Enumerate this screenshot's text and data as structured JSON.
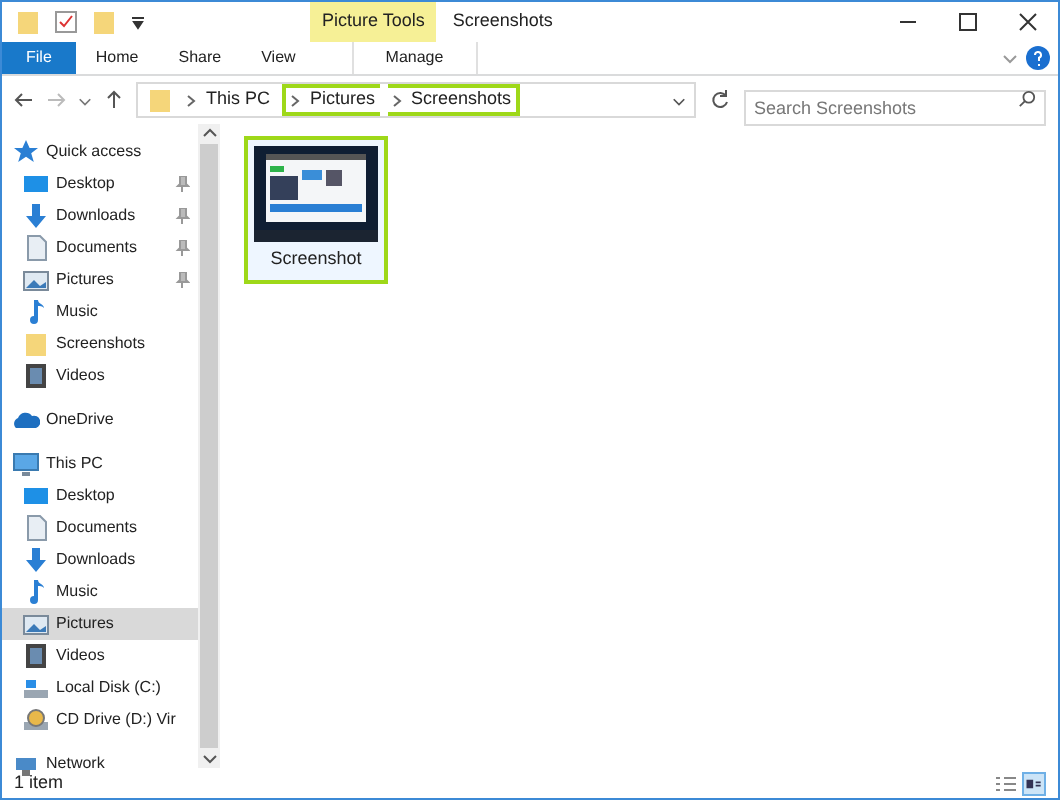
{
  "window": {
    "title": "Screenshots",
    "context_tab": "Picture Tools"
  },
  "ribbon_tabs": [
    {
      "label": "File",
      "kind": "file",
      "selected": false
    },
    {
      "label": "Home",
      "kind": "tab",
      "selected": false
    },
    {
      "label": "Share",
      "kind": "tab",
      "selected": false
    },
    {
      "label": "View",
      "kind": "tab",
      "selected": false
    },
    {
      "label": "Manage",
      "kind": "context",
      "selected": false
    }
  ],
  "address": {
    "crumbs": [
      {
        "label": "This PC",
        "highlighted": false
      },
      {
        "label": "Pictures",
        "highlighted": true
      },
      {
        "label": "Screenshots",
        "highlighted": true
      }
    ]
  },
  "search": {
    "placeholder": "Search Screenshots"
  },
  "sidebar": {
    "items": [
      {
        "label": "Quick access",
        "kind": "star",
        "selected": false,
        "children": [
          {
            "label": "Desktop",
            "kind": "desktop",
            "pinned": true,
            "selected": false
          },
          {
            "label": "Downloads",
            "kind": "download",
            "pinned": true,
            "selected": false
          },
          {
            "label": "Documents",
            "kind": "document",
            "pinned": true,
            "selected": false
          },
          {
            "label": "Pictures",
            "kind": "pictures",
            "pinned": true,
            "selected": false
          },
          {
            "label": "Music",
            "kind": "music",
            "pinned": false,
            "selected": false
          },
          {
            "label": "Screenshots",
            "kind": "folder",
            "pinned": false,
            "selected": false
          },
          {
            "label": "Videos",
            "kind": "videos",
            "pinned": false,
            "selected": false
          }
        ]
      },
      {
        "label": "OneDrive",
        "kind": "cloud",
        "selected": false
      },
      {
        "label": "This PC",
        "kind": "pc",
        "selected": false,
        "children": [
          {
            "label": "Desktop",
            "kind": "desktop",
            "pinned": false,
            "selected": false
          },
          {
            "label": "Documents",
            "kind": "document",
            "pinned": false,
            "selected": false
          },
          {
            "label": "Downloads",
            "kind": "download",
            "pinned": false,
            "selected": false
          },
          {
            "label": "Music",
            "kind": "music",
            "pinned": false,
            "selected": false
          },
          {
            "label": "Pictures",
            "kind": "pictures",
            "pinned": false,
            "selected": true
          },
          {
            "label": "Videos",
            "kind": "videos",
            "pinned": false,
            "selected": false
          },
          {
            "label": "Local Disk (C:)",
            "kind": "disk",
            "pinned": false,
            "selected": false
          },
          {
            "label": "CD Drive (D:) Vir",
            "kind": "cd",
            "pinned": false,
            "selected": false
          }
        ]
      },
      {
        "label": "Network",
        "kind": "network",
        "selected": false
      }
    ]
  },
  "files": [
    {
      "name": "Screenshot",
      "kind": "picture",
      "selected": true
    }
  ],
  "status_bar": {
    "count": "1 item",
    "views": [
      {
        "kind": "details",
        "selected": false
      },
      {
        "kind": "tiles",
        "selected": true
      }
    ]
  }
}
